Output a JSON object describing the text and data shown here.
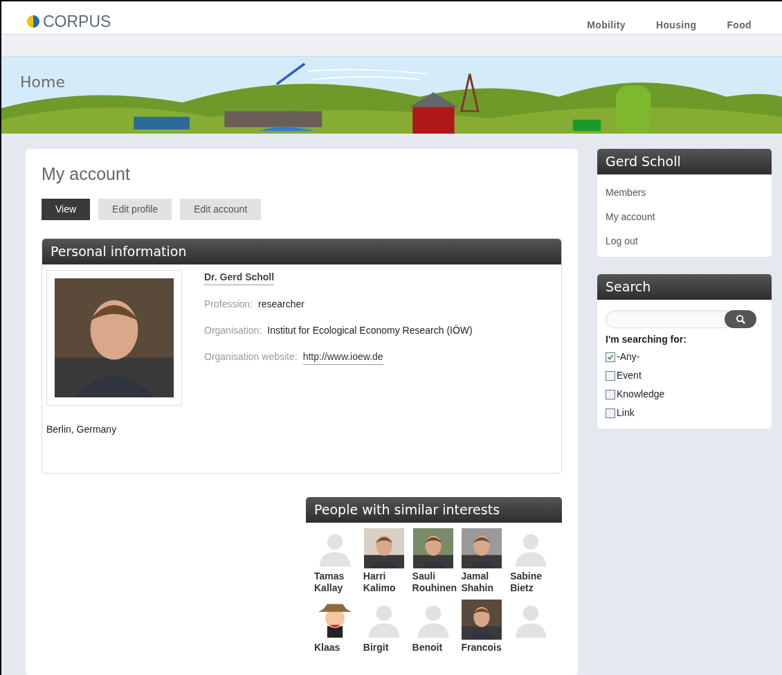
{
  "header": {
    "logo": "CORPUS",
    "nav": [
      {
        "label": "Mobility"
      },
      {
        "label": "Housing"
      },
      {
        "label": "Food"
      }
    ]
  },
  "banner": {
    "title": "Home"
  },
  "page": {
    "title": "My account",
    "tabs": [
      {
        "label": "View",
        "selected": true
      },
      {
        "label": "Edit profile",
        "selected": false
      },
      {
        "label": "Edit account",
        "selected": false
      }
    ]
  },
  "personal_information": {
    "title": "Personal information",
    "name": "Dr. Gerd Scholl",
    "fields": [
      {
        "label": "Profession:",
        "value": "researcher",
        "kind": "text"
      },
      {
        "label": "Organisation:",
        "value": "Institut for Ecological Economy Research (IÖW)",
        "kind": "text"
      },
      {
        "label": "Organisation website:",
        "value": "http://www.ioew.de",
        "kind": "link"
      }
    ],
    "location": "Berlin, Germany"
  },
  "similar_people": {
    "title": "People with similar interests",
    "people": [
      {
        "first": "Tamas",
        "last": "Kallay",
        "kind": "placeholder"
      },
      {
        "first": "Harri",
        "last": "Kalimo"
      },
      {
        "first": "Sauli",
        "last": "Rouhinen"
      },
      {
        "first": "Jamal",
        "last": "Shahin"
      },
      {
        "first": "Sabine",
        "last": "Bietz",
        "kind": "placeholder"
      },
      {
        "first": "Klaas",
        "kind": "cartoon"
      },
      {
        "first": "Birgit",
        "kind": "placeholder"
      },
      {
        "first": "Benoit",
        "kind": "placeholder"
      },
      {
        "first": "Francois"
      },
      {
        "kind": "placeholder"
      }
    ]
  },
  "user_block": {
    "title": "Gerd Scholl",
    "links": [
      {
        "label": "Members"
      },
      {
        "label": "My account"
      },
      {
        "label": "Log out"
      }
    ]
  },
  "search_block": {
    "title": "Search",
    "filter_label": "I'm searching for:",
    "options": [
      {
        "label": "-Any-",
        "checked": true
      },
      {
        "label": "Event",
        "checked": false
      },
      {
        "label": "Knowledge",
        "checked": false
      },
      {
        "label": "Link",
        "checked": false
      }
    ]
  }
}
